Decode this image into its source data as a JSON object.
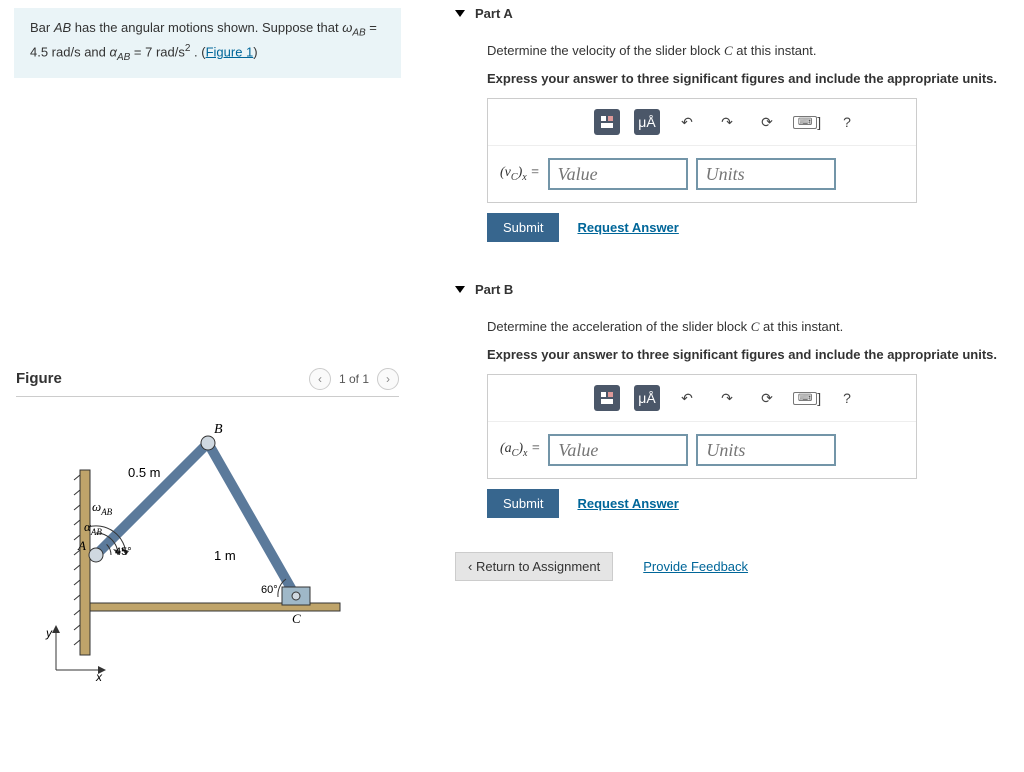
{
  "intro": {
    "text1": "Bar ",
    "bar": "AB",
    "text2": " has the angular motions shown. Suppose that ",
    "eq1a": "ω",
    "eq1sub": "AB",
    "eq1b": " = 4.5 rad/s",
    "eq_and": " and ",
    "eq2a": "α",
    "eq2sub": "AB",
    "eq2b": " = 7 rad/s",
    "eq2exp": "2",
    "period": " . ",
    "fig_paren_l": "(",
    "fig_link": "Figure 1",
    "fig_paren_r": ")"
  },
  "figure": {
    "title": "Figure",
    "counter": "1 of 1",
    "labels": {
      "B": "B",
      "len05": "0.5 m",
      "omega": "ω",
      "omegaSub": "AB",
      "alpha": "α",
      "alphaSub": "AB",
      "A": "A",
      "ang45": "45°",
      "len1": "1 m",
      "ang60": "60°",
      "C": "C",
      "y": "y",
      "x": "x"
    }
  },
  "partA": {
    "title": "Part A",
    "q": "Determine the velocity of the slider block ",
    "var": "C",
    "q2": " at this instant.",
    "instr": "Express your answer to three significant figures and include the appropriate units.",
    "label_pre": "(v",
    "label_subC": "C",
    "label_close": ")",
    "label_subx": "x",
    "label_eq": " =",
    "value_ph": "Value",
    "units_ph": "Units",
    "submit": "Submit",
    "request": "Request Answer",
    "tool_unit": "μÅ",
    "help": "?"
  },
  "partB": {
    "title": "Part B",
    "q": "Determine the acceleration of the slider block ",
    "var": "C",
    "q2": " at this instant.",
    "instr": "Express your answer to three significant figures and include the appropriate units.",
    "label_pre": "(a",
    "label_subC": "C",
    "label_close": ")",
    "label_subx": "x",
    "label_eq": " =",
    "value_ph": "Value",
    "units_ph": "Units",
    "submit": "Submit",
    "request": "Request Answer",
    "tool_unit": "μÅ",
    "help": "?"
  },
  "footer": {
    "return": "Return to Assignment",
    "feedback": "Provide Feedback"
  }
}
